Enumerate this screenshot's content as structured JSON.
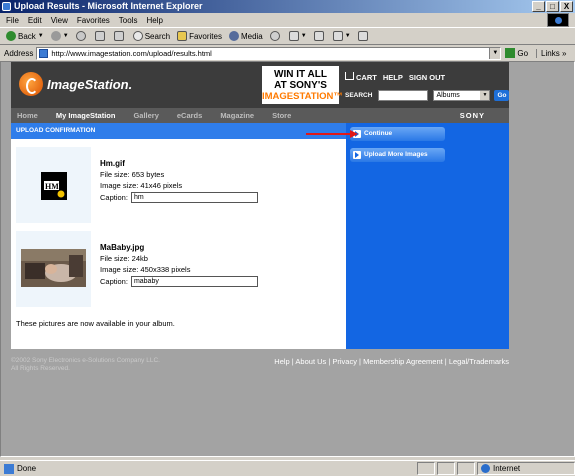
{
  "window": {
    "title": "Upload Results - Microsoft Internet Explorer",
    "minimize": "_",
    "maximize": "□",
    "close": "X"
  },
  "menu": [
    "File",
    "Edit",
    "View",
    "Favorites",
    "Tools",
    "Help"
  ],
  "toolbar": {
    "back": "Back",
    "search": "Search",
    "favorites": "Favorites",
    "media": "Media"
  },
  "address": {
    "label": "Address",
    "url": "http://www.imagestation.com/upload/results.html",
    "go": "Go",
    "links": "Links"
  },
  "site": {
    "logo_text": "ImageStation.",
    "ad_lines": [
      "WIN IT ALL",
      "AT SONY'S",
      "IMAGESTATION™"
    ],
    "top_links": [
      "CART",
      "HELP",
      "SIGN OUT"
    ],
    "search_label": "SEARCH",
    "search_value": "",
    "search_scope": "Albums",
    "search_go": "Go",
    "nav": [
      "Home",
      "My ImageStation",
      "Gallery",
      "eCards",
      "Magazine",
      "Store"
    ],
    "nav_active": "My ImageStation",
    "brand": "SONY"
  },
  "main": {
    "section_title": "UPLOAD CONFIRMATION",
    "uploads": [
      {
        "name": "Hm.gif",
        "size": "File size: 653 bytes",
        "dims": "Image size: 41x46 pixels",
        "caption_label": "Caption:",
        "caption_value": "hm"
      },
      {
        "name": "MaBaby.jpg",
        "size": "File size: 24kb",
        "dims": "Image size: 450x338 pixels",
        "caption_label": "Caption:",
        "caption_value": "mababy"
      }
    ],
    "note": "These pictures are now available in your album."
  },
  "side": {
    "continue": "Continue",
    "upload_more": "Upload More Images"
  },
  "footer": {
    "copyright_1": "©2002 Sony Electronics e-Solutions Company LLC.",
    "copyright_2": "All Rights Reserved.",
    "links": "Help | About Us | Privacy | Membership Agreement | Legal/Trademarks"
  },
  "status": {
    "text": "Done",
    "zone": "Internet"
  },
  "colors": {
    "accent_blue": "#1366e3",
    "bar_blue": "#2f7dea",
    "header_dark": "#3c3c3c",
    "ad_orange": "#ff7a00",
    "arrow_red": "#e01818"
  }
}
